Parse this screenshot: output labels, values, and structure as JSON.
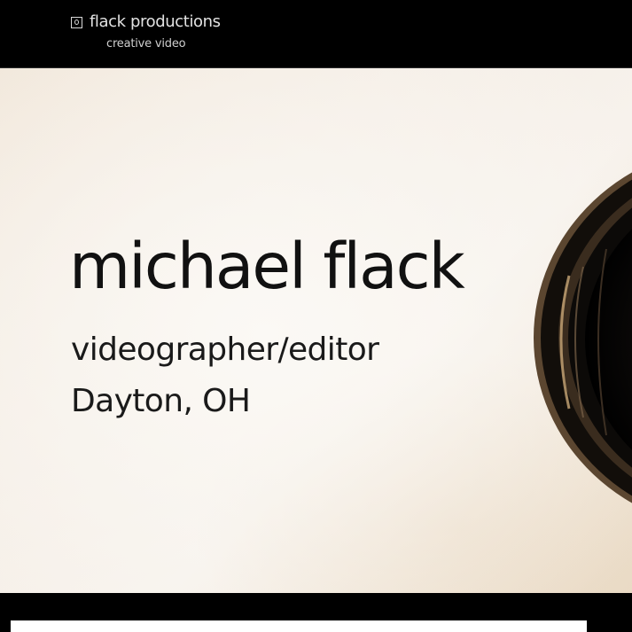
{
  "header": {
    "logo": {
      "name": "flack productions",
      "tagline": "creative video",
      "icon": "logo-mark-icon"
    }
  },
  "hero": {
    "name": "michael flack",
    "role": "videographer/editor",
    "location": "Dayton, OH",
    "image": "camera-lens-image"
  },
  "colors": {
    "header_bg": "#000000",
    "hero_bg": "#f5eee6",
    "text": "#111111",
    "card": "#ffffff"
  }
}
